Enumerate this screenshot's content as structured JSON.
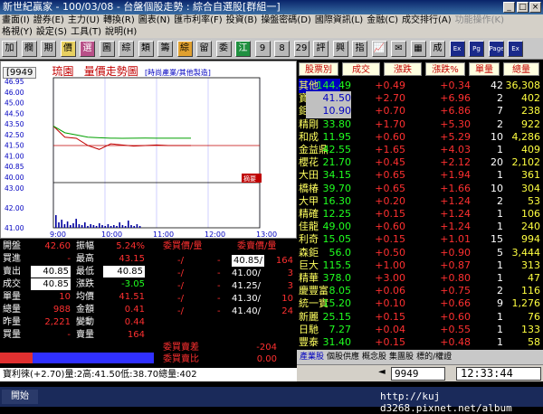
{
  "window": {
    "title": "新世紀贏家 - 100/03/08 - 台盤個股走勢 : 綜合自選股[群組一]"
  },
  "menu": {
    "row1": [
      "畫面(I)",
      "證券(E)",
      "主力(U)",
      "轉換(R)",
      "圖表(N)",
      "匯市利率(F)",
      "投資(B)",
      "操盤密碼(D)",
      "國際資訊(L)",
      "金融(C)",
      "成交排行(A)",
      "功能操作(K)"
    ],
    "row2": [
      "格視(Y)",
      "設定(S)",
      "工具(T)",
      "說明(H)"
    ]
  },
  "toolbar": {
    "buttons": [
      "加",
      "欄",
      "期",
      "價",
      "選",
      "圖",
      "綜",
      "類",
      "籌",
      "綜",
      "留",
      "委",
      "江",
      "9",
      "8",
      "29",
      "評",
      "興",
      "指",
      "📈",
      "✉",
      "▦",
      "成",
      "Ex",
      "Pg",
      "Page",
      "Ex"
    ]
  },
  "chart": {
    "code": "[9949",
    "name": "琉園",
    "title": "量價走勢圖",
    "category": "[時尚產業/其他製造]",
    "y_ticks": [
      "46.95",
      "46.00",
      "45.00",
      "44.50",
      "43.50",
      "42.50",
      "41.50",
      "41.00",
      "40.85",
      "40.00",
      "43.00",
      "42.00",
      "41.00"
    ],
    "x_ticks": [
      "9:00",
      "10:00",
      "11:00",
      "12:00",
      "13:00"
    ],
    "badge": "摘要",
    "line_color": "#c00000",
    "ma_color": "#00a000"
  },
  "chart_data": {
    "type": "line",
    "title": "量價走勢圖",
    "xlabel": "",
    "ylabel": "",
    "x": [
      "9:00",
      "9:10",
      "9:20",
      "9:30",
      "9:40",
      "9:50",
      "10:00",
      "10:10",
      "10:20",
      "10:30",
      "10:40",
      "10:50",
      "11:00"
    ],
    "series": [
      {
        "values": [
          42.6,
          41.6,
          41.5,
          40.85,
          40.5,
          41.0,
          40.9,
          40.8,
          40.85,
          40.9,
          40.85,
          40.85,
          40.85
        ]
      },
      {
        "values": [
          42.6,
          42.0,
          41.8,
          41.6,
          41.55,
          41.51,
          41.5,
          41.51,
          41.52,
          41.51,
          41.51,
          41.51,
          41.51
        ]
      }
    ],
    "ylim": [
      38.0,
      46.95
    ],
    "ref_line": 40.85
  },
  "quote": {
    "left_rows": [
      {
        "label": "開盤",
        "value": "42.60",
        "label2": "振幅",
        "value2": "5.24%"
      },
      {
        "label": "買進",
        "value": "-",
        "label2": "最高",
        "value2": "43.15"
      },
      {
        "label": "賣出",
        "value": "40.85",
        "label2": "最低",
        "value2": "40.85"
      },
      {
        "label": "成交",
        "value": "40.85",
        "label2": "漲跌",
        "value2": "-3.05"
      },
      {
        "label": "單量",
        "value": "10",
        "label2": "均價",
        "value2": "41.51"
      },
      {
        "label": "總量",
        "value": "988",
        "label2": "金額",
        "value2": "0.41"
      },
      {
        "label": "昨量",
        "value": "2,221",
        "label2": "變動",
        "value2": "0.44"
      },
      {
        "label": "買量",
        "value": "-",
        "label2": "賣量",
        "value2": "164"
      }
    ],
    "bid_header": "委買價/量",
    "ask_header": "委賣價/量",
    "bids": [
      {
        "price": "-/",
        "qty": "-"
      },
      {
        "price": "-/",
        "qty": "-"
      },
      {
        "price": "-/",
        "qty": "-"
      },
      {
        "price": "-/",
        "qty": "-"
      },
      {
        "price": "-/",
        "qty": "-"
      }
    ],
    "asks": [
      {
        "price": "40.85/",
        "qty": "164"
      },
      {
        "price": "41.00/",
        "qty": "3"
      },
      {
        "price": "41.25/",
        "qty": "3"
      },
      {
        "price": "41.30/",
        "qty": "10"
      },
      {
        "price": "41.40/",
        "qty": "24"
      }
    ],
    "diff_label": "委買賣差",
    "diff_value": "-204",
    "ratio_label": "委買賣比",
    "ratio_value": "0.00"
  },
  "bottom_text": "寶利徠(+2.70)量:2高:41.50低:38.70總量:402",
  "list": {
    "headers": [
      "股票別",
      "成交",
      "漲跌",
      "漲跌%",
      "單量",
      "總量"
    ],
    "rows": [
      {
        "name": "其他",
        "price": "144.49",
        "change": "+0.49",
        "pct": "+0.34",
        "vol": "42",
        "total": "36,308"
      },
      {
        "name": "寶利徠",
        "price": "41.50",
        "change": "+2.70",
        "pct": "+6.96",
        "vol": "2",
        "total": "402"
      },
      {
        "name": "鉅明",
        "price": "10.90",
        "change": "+0.70",
        "pct": "+6.86",
        "vol": "7",
        "total": "238"
      },
      {
        "name": "精剛",
        "price": "33.80",
        "change": "+1.70",
        "pct": "+5.30",
        "vol": "2",
        "total": "922"
      },
      {
        "name": "和成",
        "price": "11.95",
        "change": "+0.60",
        "pct": "+5.29",
        "vol": "10",
        "total": "4,286"
      },
      {
        "name": "金益鼎",
        "price": "42.55",
        "change": "+1.65",
        "pct": "+4.03",
        "vol": "1",
        "total": "409"
      },
      {
        "name": "櫻花",
        "price": "21.70",
        "change": "+0.45",
        "pct": "+2.12",
        "vol": "20",
        "total": "2,102"
      },
      {
        "name": "大田",
        "price": "34.15",
        "change": "+0.65",
        "pct": "+1.94",
        "vol": "1",
        "total": "361"
      },
      {
        "name": "橋椿",
        "price": "39.70",
        "change": "+0.65",
        "pct": "+1.66",
        "vol": "10",
        "total": "304"
      },
      {
        "name": "大甲",
        "price": "16.30",
        "change": "+0.20",
        "pct": "+1.24",
        "vol": "2",
        "total": "53"
      },
      {
        "name": "精確",
        "price": "12.25",
        "change": "+0.15",
        "pct": "+1.24",
        "vol": "1",
        "total": "106"
      },
      {
        "name": "佳龍",
        "price": "49.00",
        "change": "+0.60",
        "pct": "+1.24",
        "vol": "1",
        "total": "240"
      },
      {
        "name": "利奇",
        "price": "15.05",
        "change": "+0.15",
        "pct": "+1.01",
        "vol": "15",
        "total": "994"
      },
      {
        "name": "森鉅",
        "price": "56.0",
        "change": "+0.50",
        "pct": "+0.90",
        "vol": "5",
        "total": "3,444"
      },
      {
        "name": "巨大",
        "price": "115.5",
        "change": "+1.00",
        "pct": "+0.87",
        "vol": "1",
        "total": "313"
      },
      {
        "name": "精華",
        "price": "378.0",
        "change": "+3.00",
        "pct": "+0.80",
        "vol": "1",
        "total": "47"
      },
      {
        "name": "慶豐富",
        "price": "8.05",
        "change": "+0.06",
        "pct": "+0.75",
        "vol": "2",
        "total": "116"
      },
      {
        "name": "統一實",
        "price": "15.20",
        "change": "+0.10",
        "pct": "+0.66",
        "vol": "9",
        "total": "1,276"
      },
      {
        "name": "新麗",
        "price": "25.15",
        "change": "+0.15",
        "pct": "+0.60",
        "vol": "1",
        "total": "76"
      },
      {
        "name": "日馳",
        "price": "7.27",
        "change": "+0.04",
        "pct": "+0.55",
        "vol": "1",
        "total": "133"
      },
      {
        "name": "豐泰",
        "price": "31.40",
        "change": "+0.15",
        "pct": "+0.48",
        "vol": "1",
        "total": "58"
      }
    ]
  },
  "tabs": [
    "產業股",
    "個股供應",
    "概念股",
    "集團股",
    "標的/權證"
  ],
  "status": {
    "code": "9949",
    "time": "12:33:44"
  },
  "taskbar": {
    "start": "開始",
    "url": "http://kuj d3268.pixnet.net/album"
  }
}
